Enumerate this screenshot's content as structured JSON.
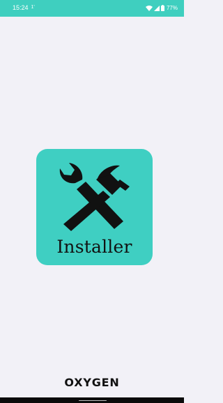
{
  "status_bar": {
    "time": "15:24",
    "extra": "1'",
    "battery": "77%",
    "icons": [
      "wifi-icon",
      "signal-icon",
      "battery-icon"
    ]
  },
  "splash": {
    "app_name": "Installer",
    "icon": "tools-icon",
    "tile_color": "#3fcfc2"
  },
  "footer": {
    "brand": "OXYGEN"
  },
  "colors": {
    "status_bar": "#3fcfbf",
    "background": "#f2f1f7"
  }
}
